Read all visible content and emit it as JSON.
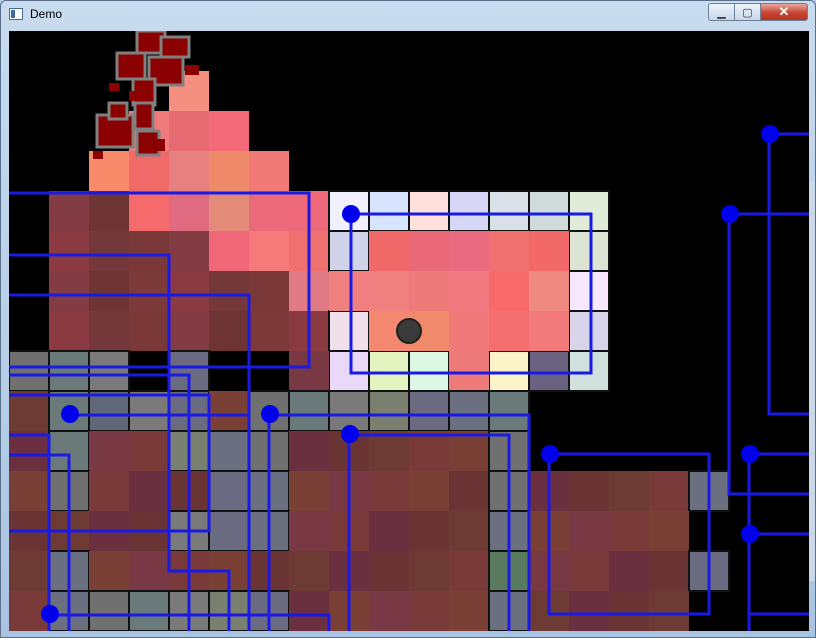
{
  "window": {
    "title": "Demo",
    "minimize_icon": "minimize-icon",
    "maximize_icon": "maximize-icon",
    "close_icon": "close-icon",
    "minimize_glyph": "▁",
    "maximize_glyph": "▢",
    "close_glyph": "✕"
  },
  "colors": {
    "background": "#000000",
    "path_line": "#1a1ae6",
    "node": "#0000ee",
    "player": "#3a3a3a",
    "blob": "#8b0000",
    "blob_outline": "#808080"
  }
}
